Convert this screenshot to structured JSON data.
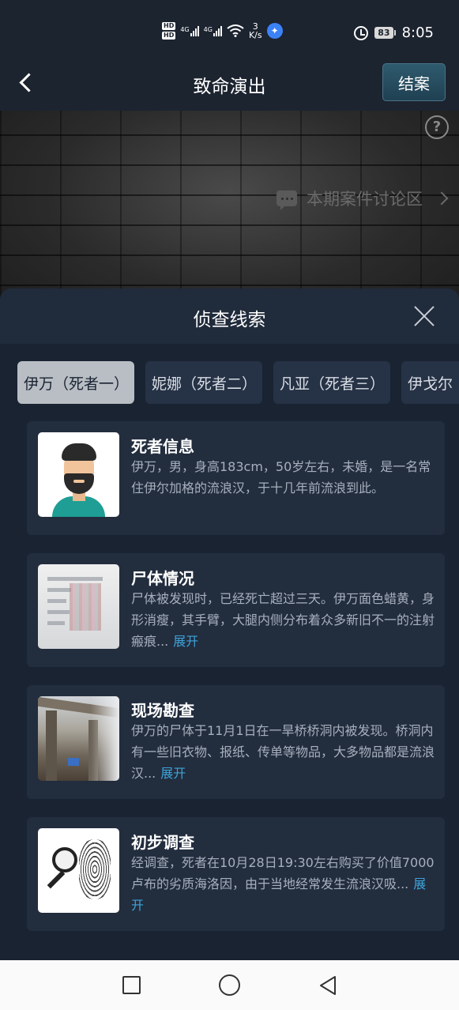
{
  "status_bar": {
    "hd_badges": [
      "HD",
      "HD"
    ],
    "networks": [
      "4G",
      "4G"
    ],
    "speed_value": "3",
    "speed_unit": "K/s",
    "battery_level": "83",
    "time": "8:05",
    "icons": [
      "alarm-icon",
      "wifi-icon",
      "baidu-icon"
    ]
  },
  "header": {
    "title": "致命演出",
    "close_case_label": "结案"
  },
  "background": {
    "discussion_label": "本期案件讨论区"
  },
  "sheet": {
    "title": "侦查线索",
    "tabs": [
      {
        "label": "伊万（死者一）",
        "active": true
      },
      {
        "label": "妮娜（死者二）",
        "active": false
      },
      {
        "label": "凡亚（死者三）",
        "active": false
      },
      {
        "label": "伊戈尔（",
        "active": false
      }
    ],
    "cards": [
      {
        "title": "死者信息",
        "body": "伊万，男，身高183cm，50岁左右，未婚，是一名常住伊尔加格的流浪汉，于十几年前流浪到此。",
        "expand": ""
      },
      {
        "title": "尸体情况",
        "body": "尸体被发现时，已经死亡超过三天。伊万面色蜡黄，身形消瘦，其手臂，大腿内侧分布着众多新旧不一的注射瘢痕...",
        "expand": "展开"
      },
      {
        "title": "现场勘查",
        "body": "伊万的尸体于11月1日在一旱桥桥洞内被发现。桥洞内有一些旧衣物、报纸、传单等物品，大多物品都是流浪汉...",
        "expand": "展开"
      },
      {
        "title": "初步调查",
        "body": "经调查，死者在10月28日19:30左右购买了价值7000卢布的劣质海洛因，由于当地经常发生流浪汉吸...",
        "expand": "展开"
      }
    ]
  },
  "colors": {
    "accent_link": "#3ea3d8",
    "active_tab_bg": "#b9bec4",
    "sheet_bg": "#1a2332",
    "card_bg": "#222d3e"
  }
}
